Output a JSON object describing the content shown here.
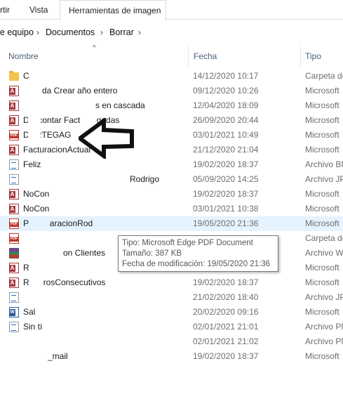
{
  "ribbon": {
    "tab_partial": "rtir",
    "tab_vista": "Vista",
    "tab_herramientas": "Herramientas de imagen"
  },
  "breadcrumb": {
    "items": [
      "e equipo",
      "Documentos",
      "Borrar"
    ]
  },
  "columns": {
    "nombre": "Nombre",
    "fecha": "Fecha",
    "tipo": "Tipo"
  },
  "files": [
    {
      "name": "C",
      "date": "14/12/2020 10:17",
      "type": "Carpeta de",
      "icon": "folder-icon"
    },
    {
      "name": "da Crear año entero",
      "date": "09/12/2020 10:26",
      "type": "Microsoft",
      "icon": "access-file-icon"
    },
    {
      "name": "s en cascada",
      "date": "12/04/2020 18:09",
      "type": "Microsoft",
      "icon": "access-file-icon"
    },
    {
      "name": "Descontar Fact       gadas",
      "date": "26/09/2020 20:44",
      "type": "Microsoft",
      "icon": "access-file-icon"
    },
    {
      "name": "DORTEGAG",
      "date": "03/01/2021 10:49",
      "type": "Microsoft",
      "icon": "pdf-file-icon"
    },
    {
      "name": "FacturacionActual",
      "date": "21/12/2020 21:04",
      "type": "Microsoft",
      "icon": "access-file-icon"
    },
    {
      "name": "Feliz",
      "date": "19/02/2020 18:37",
      "type": "Archivo BN",
      "icon": "document-icon"
    },
    {
      "name": "Rodrigo",
      "date": "05/09/2020 14:25",
      "type": "Archivo JP",
      "icon": "image-file-icon"
    },
    {
      "name": "NoCon",
      "date": "19/02/2020 18:37",
      "type": "Microsoft",
      "icon": "access-file-icon"
    },
    {
      "name": "NoCon",
      "date": "03/01/2021 10:38",
      "type": "Microsoft",
      "icon": "access-file-icon"
    },
    {
      "name": "P         aracionRod",
      "date": "19/05/2020 21:36",
      "type": "Microsoft",
      "icon": "pdf-file-icon"
    },
    {
      "name": "",
      "date": "",
      "type": "Carpeta de",
      "icon": "pdf-file-icon"
    },
    {
      "name": "on Clientes",
      "date": "",
      "type": "Archivo W",
      "icon": "archive-file-icon"
    },
    {
      "name": "R",
      "date": "",
      "type": "Microsoft",
      "icon": "access-file-icon"
    },
    {
      "name": "R      rosConsecutivos",
      "date": "19/02/2020 18:37",
      "type": "Microsoft",
      "icon": "access-file-icon"
    },
    {
      "name": "",
      "date": "21/02/2020 18:40",
      "type": "Archivo JP",
      "icon": "image-file-icon"
    },
    {
      "name": "Sal",
      "date": "20/02/2020 09:16",
      "type": "Microsoft",
      "icon": "word-file-icon"
    },
    {
      "name": "Sin tí",
      "date": "02/01/2021 21:01",
      "type": "Archivo PN",
      "icon": "image-file-icon"
    },
    {
      "name": "",
      "date": "02/01/2021 21:02",
      "type": "Archivo PN",
      "icon": "image-file-icon"
    },
    {
      "name": "_mail",
      "date": "19/02/2020 18:37",
      "type": "Microsoft",
      "icon": "access-file-icon"
    }
  ],
  "tooltip": {
    "tipo": "Tipo: Microsoft Edge PDF Document",
    "tamano": "Tamaño: 387 KB",
    "fecha": "Fecha de modificación: 19/05/2020 21:36"
  },
  "colors": {
    "selected_row": "#e5f3ff",
    "header_text": "#4c607a",
    "arrow": "#111111"
  }
}
